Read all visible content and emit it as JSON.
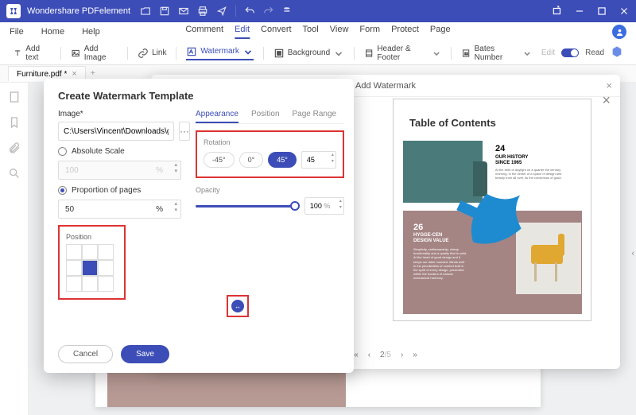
{
  "titlebar": {
    "appname": "Wondershare PDFelement"
  },
  "menubar": {
    "file": "File",
    "home": "Home",
    "help": "Help",
    "tabs": {
      "comment": "Comment",
      "edit": "Edit",
      "convert": "Convert",
      "tool": "Tool",
      "view": "View",
      "form": "Form",
      "protect": "Protect",
      "page": "Page"
    }
  },
  "toolbar": {
    "add_text": "Add text",
    "add_image": "Add Image",
    "link": "Link",
    "watermark": "Watermark",
    "background": "Background",
    "header_footer": "Header & Footer",
    "bates": "Bates Number",
    "edit": "Edit",
    "read": "Read"
  },
  "doc_tab": {
    "name": "Furniture.pdf *"
  },
  "add_dlg": {
    "title": "Add Watermark"
  },
  "create_dlg": {
    "title": "Create Watermark Template",
    "image_lbl": "Image*",
    "path": "C:\\Users\\Vincent\\Downloads\\good.",
    "abs_scale": "Absolute Scale",
    "abs_val": "100",
    "prop": "Proportion of pages",
    "prop_val": "50",
    "pct": "%",
    "position": "Position",
    "cancel": "Cancel",
    "save": "Save",
    "tabs": {
      "appearance": "Appearance",
      "position": "Position",
      "page_range": "Page Range"
    },
    "rotation_lbl": "Rotation",
    "rot_neg45": "-45°",
    "rot_0": "0°",
    "rot_45": "45°",
    "rot_val": "45",
    "opacity_lbl": "Opacity",
    "opacity_val": "100",
    "opacity_pct": "%"
  },
  "preview": {
    "toc": "Table of Contents",
    "n24": "24",
    "h24a": "OUR HISTORY",
    "h24b": "SINCE 1965",
    "b24": "At the birth of daylight on a quarter the century morning, in the center of a space of design and beauty from all over, its the consensus of good.",
    "n26": "26",
    "h26a": "HYGGE-CEN",
    "h26b": "DESIGN VALUE",
    "b26": "Simplicity, craftsmanship, cheap functionality and a quality that is solid. At the heart of good design and it keeps our label rounded. Minds built in the peculiarities of comfort built in the spirit of every design, presented within the borders of natural, mechanical harmony."
  },
  "pager": {
    "cur": "2",
    "total": "/5"
  }
}
